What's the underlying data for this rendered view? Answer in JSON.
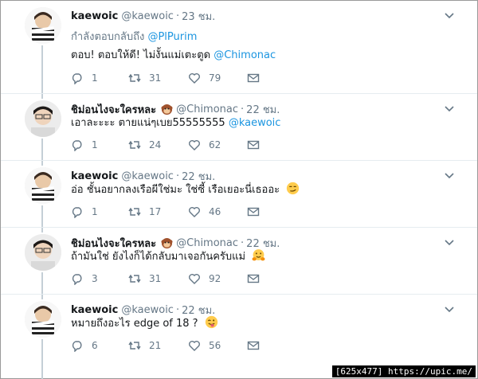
{
  "tweets": [
    {
      "name": "kaewoic",
      "handle": "@kaewoic",
      "time": "23 ชม.",
      "reply_to_prefix": "กำลังตอบกลับถึง",
      "reply_to_mention": "@PlPurim",
      "text": "ตอบ! ตอบให้ดี! ไม่งั้นแม่เตะตูด",
      "mention": "@Chimonac",
      "replies": "1",
      "retweets": "31",
      "likes": "79"
    },
    {
      "name": "ชิม่อนไงจะใครหละ",
      "handle": "@Chimonac",
      "time": "22 ชม.",
      "text": "เอาละะะะ ตายแน่ๆเบย55555555",
      "mention": "@kaewoic",
      "replies": "1",
      "retweets": "24",
      "likes": "62"
    },
    {
      "name": "kaewoic",
      "handle": "@kaewoic",
      "time": "22 ชม.",
      "text": "อ่อ ชั้นอยากลงเรือผีใช่มะ ใช่ซี้ เรือเยอะนี่เธออะ",
      "replies": "1",
      "retweets": "17",
      "likes": "46"
    },
    {
      "name": "ชิม่อนไงจะใครหละ",
      "handle": "@Chimonac",
      "time": "22 ชม.",
      "text": "ถ้ามันใช่ ยังไงก็ได้กลับมาเจอกันครับแม่",
      "replies": "3",
      "retweets": "31",
      "likes": "92"
    },
    {
      "name": "kaewoic",
      "handle": "@kaewoic",
      "time": "22 ชม.",
      "text": "หมายถึงอะไร edge of 18 ?",
      "replies": "6",
      "retweets": "21",
      "likes": "56"
    }
  ],
  "footer": "[625x477] https://upic.me/",
  "icons": {
    "reply": "reply-icon",
    "retweet": "retweet-icon",
    "like": "heart-icon",
    "dm": "envelope-icon",
    "more": "chevron-down-icon"
  },
  "colors": {
    "link": "#1b95e0",
    "muted": "#657786",
    "thread": "#c4cfd6"
  }
}
